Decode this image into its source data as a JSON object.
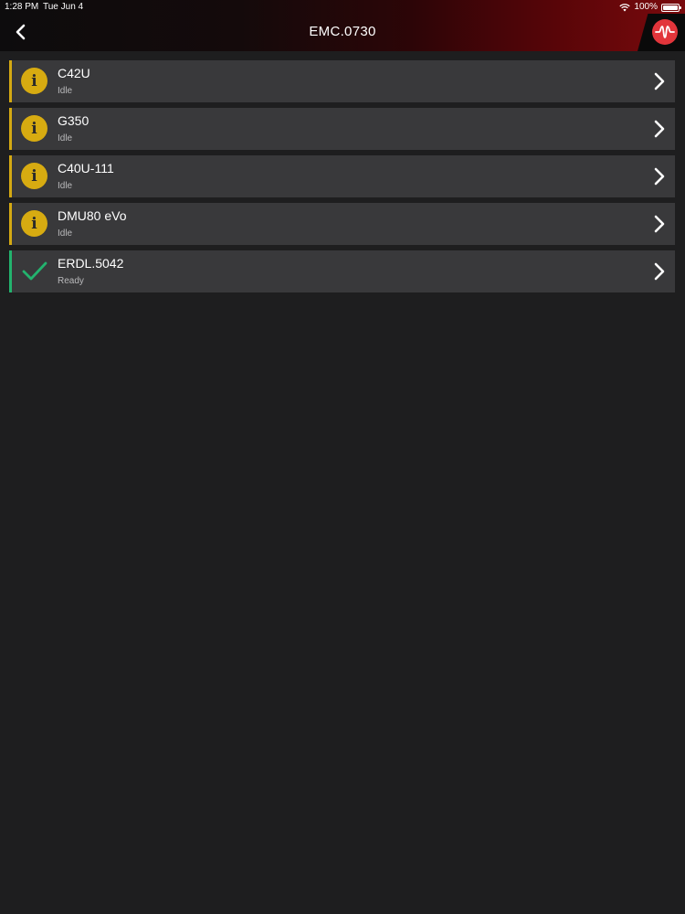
{
  "status_bar": {
    "time": "1:28 PM",
    "date": "Tue Jun 4",
    "battery": "100%"
  },
  "header": {
    "title": "EMC.0730",
    "back_icon": "chevron-left-icon",
    "logo_icon": "waveform-logo-icon"
  },
  "colors": {
    "idle": "#d7ab11",
    "ready": "#23b36e",
    "row_bg": "#39393b",
    "page_bg": "#1e1e1f",
    "logo": "#e2353b"
  },
  "machines": [
    {
      "name": "C42U",
      "status": "Idle",
      "state": "idle",
      "icon": "info-icon"
    },
    {
      "name": "G350",
      "status": "Idle",
      "state": "idle",
      "icon": "info-icon"
    },
    {
      "name": "C40U-111",
      "status": "Idle",
      "state": "idle",
      "icon": "info-icon"
    },
    {
      "name": "DMU80 eVo",
      "status": "Idle",
      "state": "idle",
      "icon": "info-icon"
    },
    {
      "name": "ERDL.5042",
      "status": "Ready",
      "state": "ready",
      "icon": "checkmark-icon"
    }
  ]
}
